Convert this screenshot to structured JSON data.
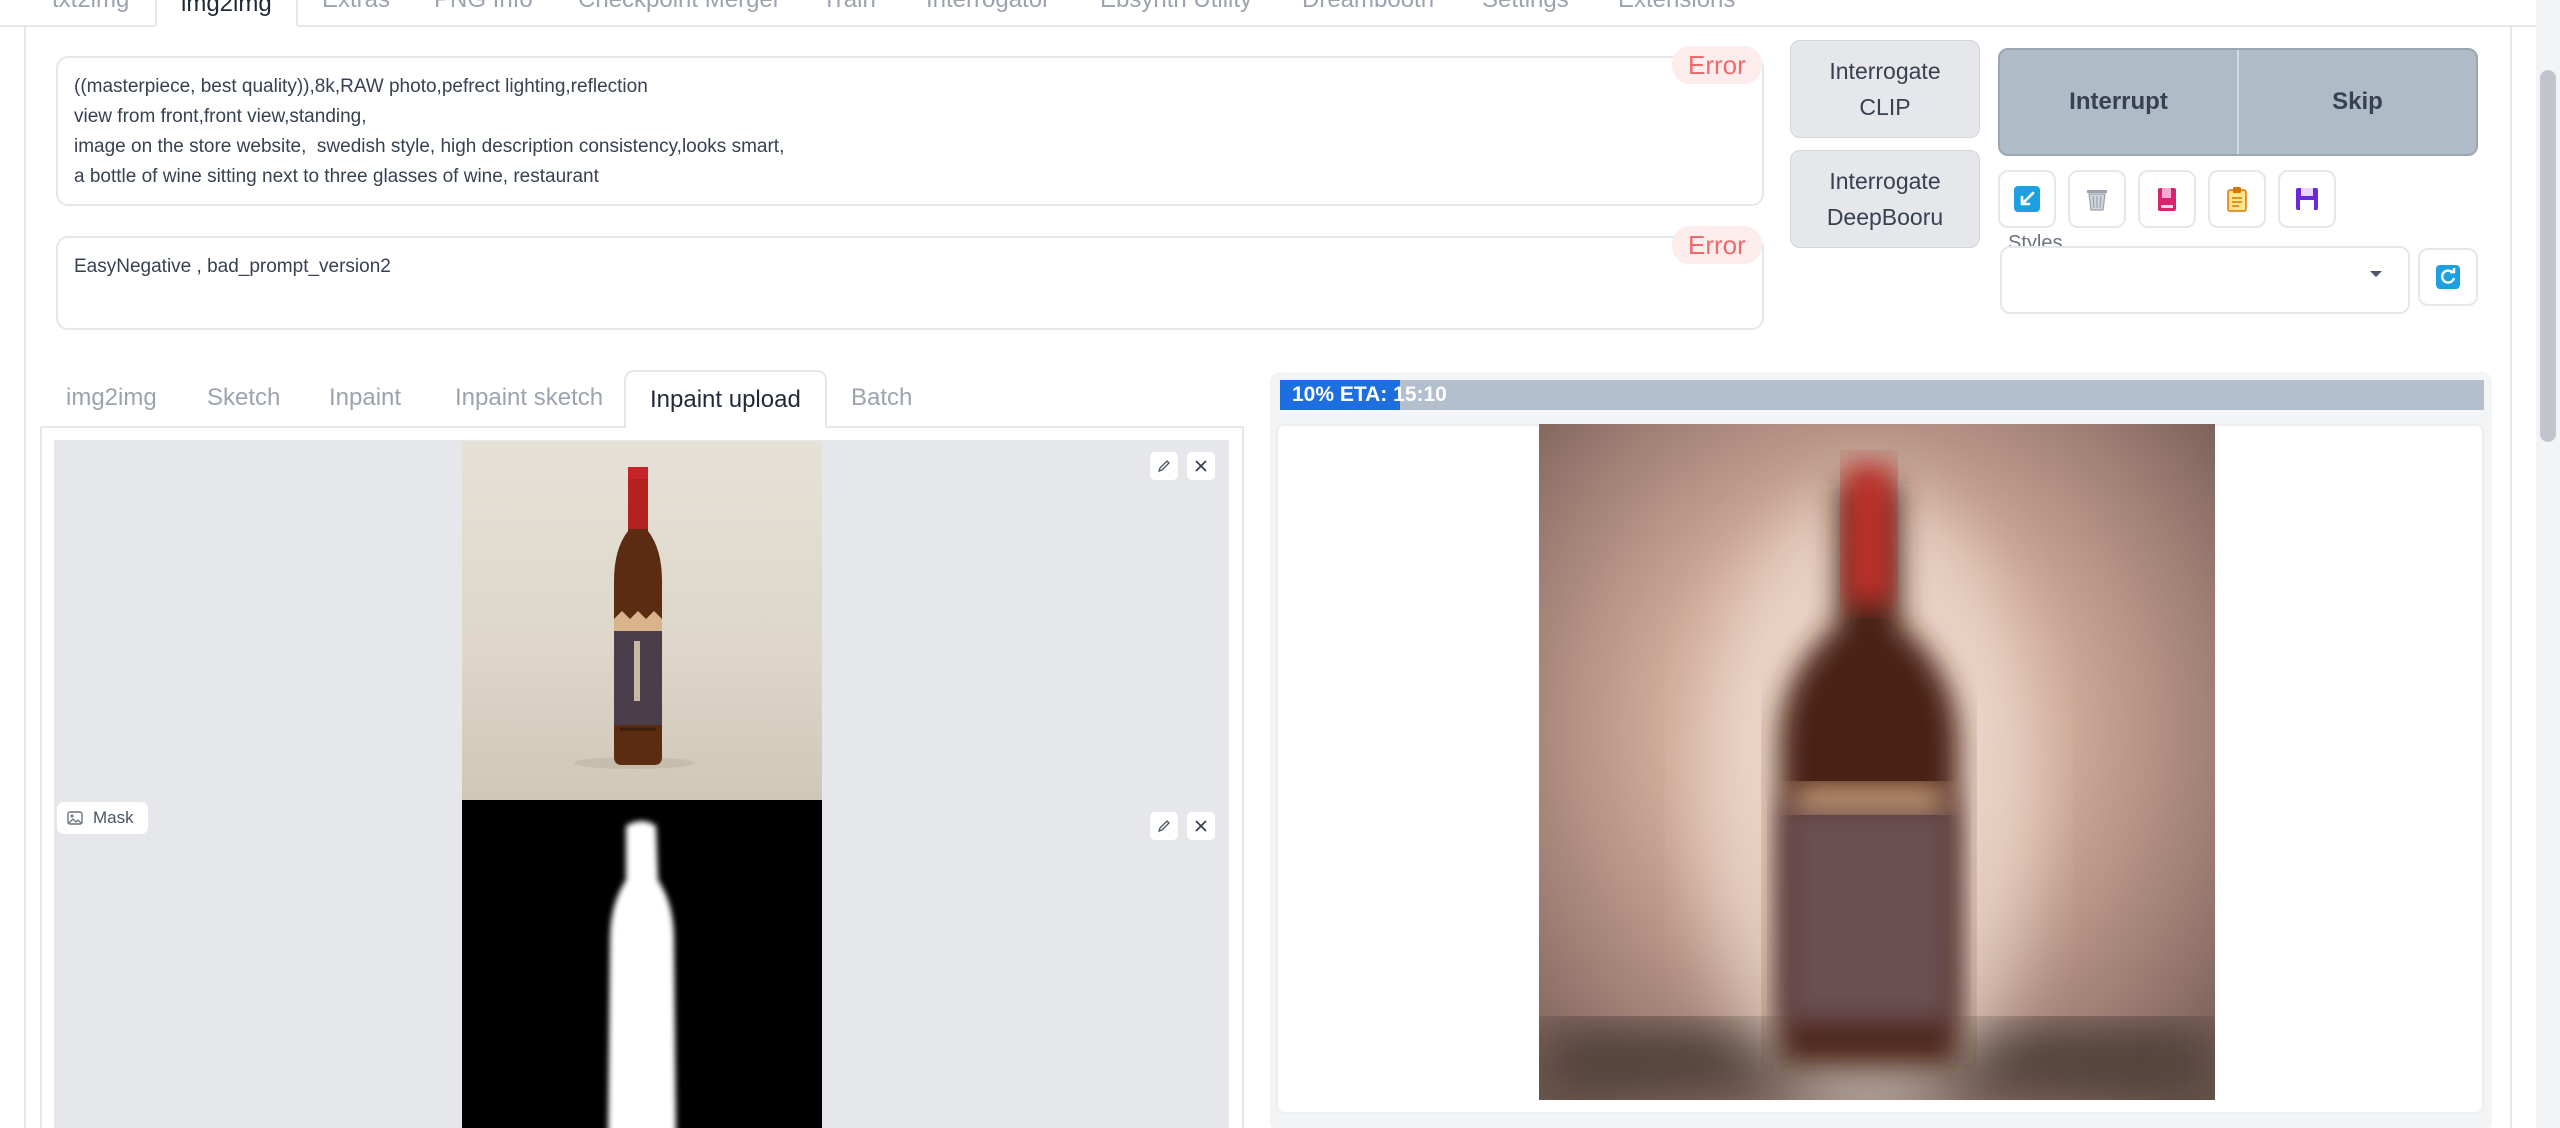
{
  "top_tabs": [
    "txt2img",
    "img2img",
    "Extras",
    "PNG Info",
    "Checkpoint Merger",
    "Train",
    "Interrogator",
    "Ebsynth Utility",
    "Dreambooth",
    "Settings",
    "Extensions"
  ],
  "prompt": {
    "lines": [
      "((masterpiece, best quality)),8k,RAW photo,pefrect lighting,reflection",
      "view from front,front view,standing,",
      "image on the store website,  swedish style, high description consistency,looks smart,",
      "a bottle of wine sitting next to three glasses of wine, restaurant"
    ],
    "error_label": "Error"
  },
  "negative_prompt": {
    "text": "EasyNegative , bad_prompt_version2",
    "error_label": "Error"
  },
  "interrogate": {
    "clip_line1": "Interrogate",
    "clip_line2": "CLIP",
    "deepbooru_line1": "Interrogate",
    "deepbooru_line2": "DeepBooru"
  },
  "actions": {
    "interrupt_label": "Interrupt",
    "skip_label": "Skip"
  },
  "tool_icons": [
    "arrow-to-prompt-icon",
    "trash-icon",
    "book-icon",
    "clipboard-icon",
    "save-icon"
  ],
  "styles": {
    "label": "Styles",
    "value": ""
  },
  "image_tabs": [
    "img2img",
    "Sketch",
    "Inpaint",
    "Inpaint sketch",
    "Inpaint upload",
    "Batch"
  ],
  "image_tabs_active": "Inpaint upload",
  "mask_label": "Mask",
  "progress": {
    "text": "10% ETA: 15:10",
    "fraction": 0.1
  },
  "colors": {
    "accent_blue": "#1d6fe0",
    "error_text": "#ef6b6b",
    "progress_track": "#b3bfcc",
    "interrupt_bg": "#b0bbc8"
  }
}
